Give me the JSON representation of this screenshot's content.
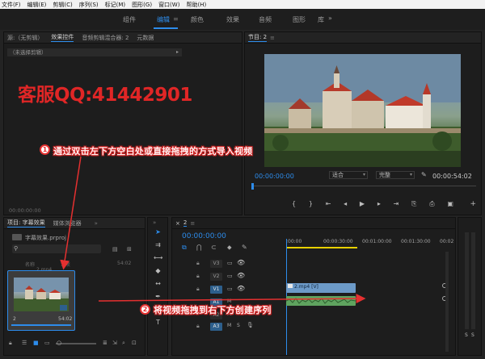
{
  "menu": [
    "文件(F)",
    "编辑(E)",
    "剪辑(C)",
    "序列(S)",
    "标记(M)",
    "图形(G)",
    "窗口(W)",
    "帮助(H)"
  ],
  "workspaces": [
    "组件",
    "编辑",
    "颜色",
    "效果",
    "音频",
    "图形",
    "库"
  ],
  "workspace_more": "»",
  "source_panel": {
    "tabs": [
      "源:（无剪辑）",
      "效果控件",
      "音频剪辑混合器: 2",
      "元数据"
    ],
    "no_selection": "（未选择剪辑）",
    "timecode": "00:00:00:00"
  },
  "watermark": "客服QQ:41442901",
  "program_panel": {
    "title": "节目: 2",
    "timecode_left": "00:00:00:00",
    "fit": "适合",
    "quality": "完整",
    "timecode_right": "00:00:54:02"
  },
  "project_panel": {
    "tabs": [
      "项目: 字幕效果",
      "媒体浏览器"
    ],
    "file": "字幕效果.prproj",
    "column_name": "名称",
    "count": "1 项",
    "clip_name": "2.mp4",
    "clip_duration": "54:02",
    "thumb_label": "2",
    "thumb_duration": "54:02"
  },
  "timeline": {
    "tab": "2",
    "timecode": "00:00:00:00",
    "ruler": [
      ":00:00",
      "00:00:30:00",
      "00:01:00:00",
      "00:01:30:00",
      "00:02"
    ],
    "video_tracks": [
      "V3",
      "V2",
      "V1"
    ],
    "audio_tracks": [
      "A1",
      "A2",
      "A3"
    ],
    "clip_label": "2.mp4 [V]"
  },
  "meter_labels": [
    "S",
    "S"
  ],
  "annotations": {
    "step1_num": "1",
    "step1_text": "通过双击左下方空白处或直接拖拽的方式导入视频",
    "step2_num": "2",
    "step2_text": "将视频拖拽到右下方创建序列"
  },
  "colors": {
    "accent": "#2d8ceb",
    "annotation": "#e53030"
  }
}
